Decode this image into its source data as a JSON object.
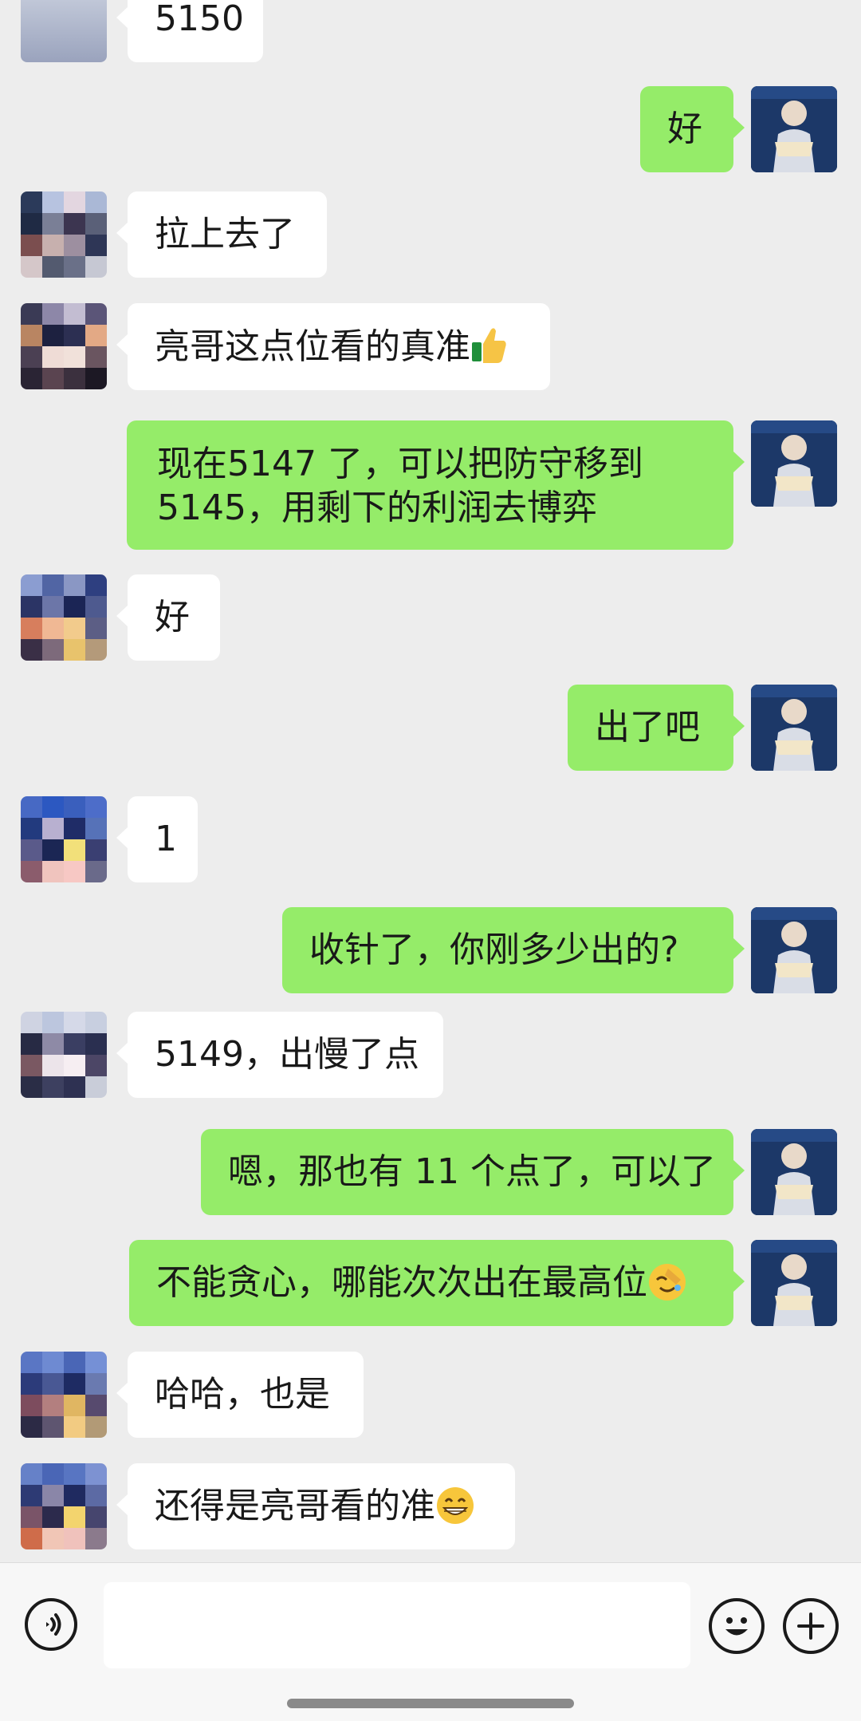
{
  "messages": [
    {
      "side": "in",
      "text": "5150",
      "cut": true
    },
    {
      "side": "out",
      "text": "好"
    },
    {
      "side": "in",
      "text": "拉上去了"
    },
    {
      "side": "in",
      "text": "亮哥这点位看的真准",
      "emoji": "thumbs-up-emoji"
    },
    {
      "side": "out",
      "text": "现在5147 了，可以把防守移到5145，用剩下的利润去博弈",
      "two_line": true
    },
    {
      "side": "in",
      "text": "好"
    },
    {
      "side": "out",
      "text": "出了吧"
    },
    {
      "side": "in",
      "text": "1"
    },
    {
      "side": "out",
      "text": "收针了，你刚多少出的?"
    },
    {
      "side": "in",
      "text": "5149，出慢了点"
    },
    {
      "side": "out",
      "text": "嗯，那也有 11 个点了，可以了"
    },
    {
      "side": "out",
      "text": "不能贪心，哪能次次出在最高位",
      "emoji": "facepalm-emoji"
    },
    {
      "side": "in",
      "text": "哈哈，也是"
    },
    {
      "side": "in",
      "text": "还得是亮哥看的准",
      "emoji": "grin-emoji"
    }
  ],
  "composer": {
    "voice_icon": "voice-icon",
    "emoji_icon": "smiley-icon",
    "add_icon": "plus-icon",
    "input_value": ""
  },
  "colors": {
    "background": "#ededed",
    "outgoing_bubble": "#95ec69",
    "incoming_bubble": "#ffffff"
  }
}
